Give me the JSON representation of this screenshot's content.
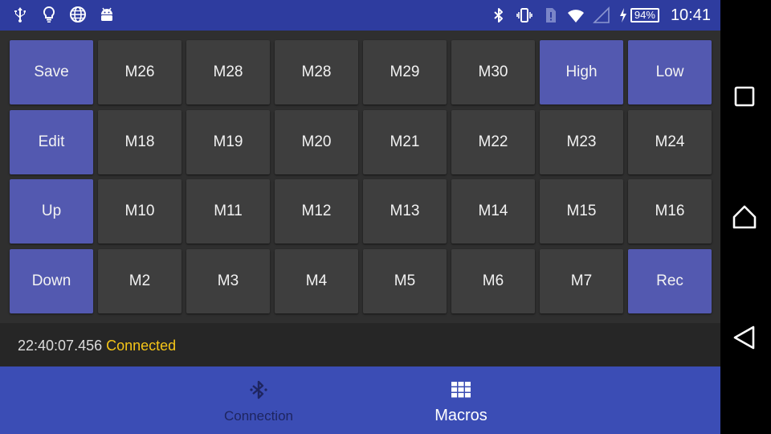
{
  "status_bar": {
    "time": "10:41",
    "battery_percent": "94%",
    "left_icons": [
      "usb-icon",
      "lightbulb-icon",
      "globe-icon",
      "android-icon"
    ],
    "right_icons": [
      "bluetooth-icon",
      "vibrate-icon",
      "sim-alert-icon",
      "wifi-icon",
      "signal-icon",
      "charging-icon"
    ]
  },
  "macro_grid": {
    "rows": [
      [
        {
          "label": "Save",
          "style": "accent"
        },
        {
          "label": "M26",
          "style": "dark"
        },
        {
          "label": "M28",
          "style": "dark"
        },
        {
          "label": "M28",
          "style": "dark"
        },
        {
          "label": "M29",
          "style": "dark"
        },
        {
          "label": "M30",
          "style": "dark"
        },
        {
          "label": "High",
          "style": "accent"
        },
        {
          "label": "Low",
          "style": "accent"
        }
      ],
      [
        {
          "label": "Edit",
          "style": "accent"
        },
        {
          "label": "M18",
          "style": "dark"
        },
        {
          "label": "M19",
          "style": "dark"
        },
        {
          "label": "M20",
          "style": "dark"
        },
        {
          "label": "M21",
          "style": "dark"
        },
        {
          "label": "M22",
          "style": "dark"
        },
        {
          "label": "M23",
          "style": "dark"
        },
        {
          "label": "M24",
          "style": "dark"
        }
      ],
      [
        {
          "label": "Up",
          "style": "accent"
        },
        {
          "label": "M10",
          "style": "dark"
        },
        {
          "label": "M11",
          "style": "dark"
        },
        {
          "label": "M12",
          "style": "dark"
        },
        {
          "label": "M13",
          "style": "dark"
        },
        {
          "label": "M14",
          "style": "dark"
        },
        {
          "label": "M15",
          "style": "dark"
        },
        {
          "label": "M16",
          "style": "dark"
        }
      ],
      [
        {
          "label": "Down",
          "style": "accent"
        },
        {
          "label": "M2",
          "style": "dark"
        },
        {
          "label": "M3",
          "style": "dark"
        },
        {
          "label": "M4",
          "style": "dark"
        },
        {
          "label": "M5",
          "style": "dark"
        },
        {
          "label": "M6",
          "style": "dark"
        },
        {
          "label": "M7",
          "style": "dark"
        },
        {
          "label": "Rec",
          "style": "accent"
        }
      ]
    ]
  },
  "log": {
    "timestamp": "22:40:07.456",
    "status": "Connected"
  },
  "bottom_nav": {
    "items": [
      {
        "label": "Connection",
        "icon": "bluetooth-icon",
        "active": false
      },
      {
        "label": "Macros",
        "icon": "grid-icon",
        "active": true
      }
    ]
  },
  "system_nav": {
    "buttons": [
      "recents-icon",
      "home-icon",
      "back-icon"
    ]
  },
  "colors": {
    "status_bar": "#2e3c9f",
    "bottom_nav": "#3b4db5",
    "accent_button": "#5359b0",
    "dark_button": "#3e3e3e",
    "status_text": "#f5c518"
  }
}
